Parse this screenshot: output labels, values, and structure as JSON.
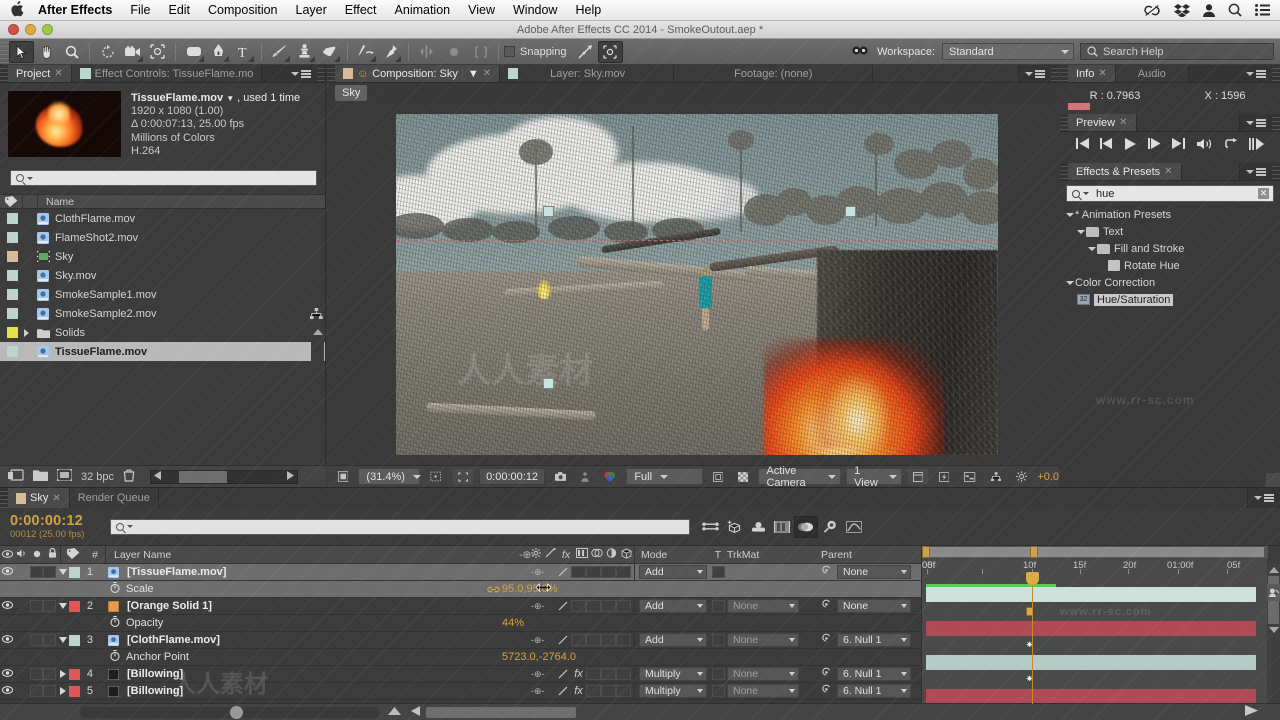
{
  "menubar": {
    "apple_icon": "apple-icon",
    "items": [
      {
        "label": "After Effects",
        "bold": true,
        "highlight": false
      },
      {
        "label": "File",
        "bold": false,
        "highlight": false
      },
      {
        "label": "Edit",
        "bold": false,
        "highlight": false
      },
      {
        "label": "Composition",
        "bold": false,
        "highlight": false
      },
      {
        "label": "Layer",
        "bold": false,
        "highlight": true
      },
      {
        "label": "Effect",
        "bold": false,
        "highlight": false
      },
      {
        "label": "Animation",
        "bold": false,
        "highlight": false
      },
      {
        "label": "View",
        "bold": false,
        "highlight": false
      },
      {
        "label": "Window",
        "bold": false,
        "highlight": false
      },
      {
        "label": "Help",
        "bold": false,
        "highlight": false
      }
    ],
    "status_icons": [
      "creative-cloud-icon",
      "dropbox-icon",
      "user-icon",
      "spotlight-search-icon",
      "notification-list-icon"
    ]
  },
  "titlebar": {
    "title": "Adobe After Effects CC 2014 - SmokeOutout.aep *",
    "close_color": "#d0524b",
    "minimize_color": "#dfa93b",
    "zoom_color": "#9ec94a"
  },
  "toolbar": {
    "tools": [
      {
        "name": "selection-tool",
        "selected": true
      },
      {
        "name": "hand-tool",
        "selected": false
      },
      {
        "name": "zoom-tool",
        "selected": false
      },
      {
        "name": "rotation-tool",
        "selected": false
      },
      {
        "name": "camera-tool",
        "selected": false
      },
      {
        "name": "pan-behind-tool",
        "selected": false
      },
      {
        "name": "shape-tool",
        "selected": false
      },
      {
        "name": "pen-tool",
        "selected": false
      },
      {
        "name": "type-tool",
        "selected": false
      },
      {
        "name": "brush-tool",
        "selected": false
      },
      {
        "name": "clone-stamp-tool",
        "selected": false
      },
      {
        "name": "eraser-tool",
        "selected": false
      },
      {
        "name": "roto-brush-tool",
        "selected": false
      },
      {
        "name": "puppet-pin-tool",
        "selected": false
      }
    ],
    "snapping_label": "Snapping",
    "snapping_checked": false,
    "workspace_label": "Workspace:",
    "workspace_value": "Standard",
    "search_help_placeholder": "Search Help"
  },
  "project": {
    "tabs": [
      {
        "label": "Project",
        "active": true,
        "closable": true
      },
      {
        "label": "Effect Controls: TissueFlame.mo",
        "active": false,
        "closable": false
      }
    ],
    "selected_asset": {
      "name": "TissueFlame.mov",
      "used": ", used 1 time",
      "dimensions": "1920 x 1080 (1.00)",
      "duration": "Δ 0:00:07:13, 25.00 fps",
      "colors": "Millions of Colors",
      "codec": "H.264"
    },
    "search_placeholder": "",
    "column_header": "Name",
    "items": [
      {
        "name": "ClothFlame.mov",
        "swatch": "#bcd4cd",
        "icon": "movie-icon",
        "selected": false,
        "folder": false
      },
      {
        "name": "FlameShot2.mov",
        "swatch": "#bcd4cd",
        "icon": "movie-icon",
        "selected": false,
        "folder": false
      },
      {
        "name": "Sky",
        "swatch": "#d7bb96",
        "icon": "composition-icon",
        "selected": false,
        "folder": false
      },
      {
        "name": "Sky.mov",
        "swatch": "#bcd4cd",
        "icon": "movie-icon",
        "selected": false,
        "folder": false
      },
      {
        "name": "SmokeSample1.mov",
        "swatch": "#bcd4cd",
        "icon": "movie-icon",
        "selected": false,
        "folder": false
      },
      {
        "name": "SmokeSample2.mov",
        "swatch": "#bcd4cd",
        "icon": "movie-icon",
        "selected": false,
        "folder": false
      },
      {
        "name": "Solids",
        "swatch": "#e3e04a",
        "icon": "folder-icon",
        "selected": false,
        "folder": true
      },
      {
        "name": "TissueFlame.mov",
        "swatch": "#bcd4cd",
        "icon": "movie-icon",
        "selected": true,
        "folder": false
      }
    ],
    "bottom": {
      "bit_depth": "32 bpc",
      "icons": [
        "new-comp-icon",
        "new-folder-icon",
        "interpret-footage-icon",
        "delete-icon"
      ]
    }
  },
  "composition": {
    "tabs": [
      {
        "label": "Composition: Sky",
        "active": true
      },
      {
        "label": "Layer: Sky.mov",
        "active": false
      },
      {
        "label": "Footage: (none)",
        "active": false
      }
    ],
    "breadcrumb": "Sky",
    "bottom": {
      "zoom": "(31.4%)",
      "timecode": "0:00:00:12",
      "resolution": "Full",
      "view_camera": "Active Camera",
      "views": "1 View",
      "exposure": "+0.0"
    }
  },
  "info_panel": {
    "tabs": [
      {
        "label": "Info",
        "active": true
      },
      {
        "label": "Audio",
        "active": false
      }
    ],
    "r_label": "R : 0.7963",
    "x_label": "X : 1596"
  },
  "preview_panel": {
    "tabs": [
      {
        "label": "Preview",
        "active": true
      }
    ],
    "buttons": [
      "first-frame-icon",
      "previous-frame-icon",
      "play-icon",
      "next-frame-icon",
      "last-frame-icon",
      "audio-icon",
      "loop-icon",
      "ram-preview-icon"
    ]
  },
  "effects_panel": {
    "tabs": [
      {
        "label": "Effects & Presets",
        "active": true
      }
    ],
    "search_value": "hue",
    "tree": [
      {
        "label": "* Animation Presets",
        "depth": 0,
        "type": "group",
        "expanded": true,
        "selected": false
      },
      {
        "label": "Text",
        "depth": 1,
        "type": "folder",
        "expanded": true,
        "selected": false
      },
      {
        "label": "Fill and Stroke",
        "depth": 2,
        "type": "folder",
        "expanded": true,
        "selected": false
      },
      {
        "label": "Rotate Hue",
        "depth": 3,
        "type": "preset",
        "expanded": false,
        "selected": false
      },
      {
        "label": "Color Correction",
        "depth": 0,
        "type": "group",
        "expanded": true,
        "selected": false
      },
      {
        "label": "Hue/Saturation",
        "depth": 1,
        "type": "effect",
        "expanded": false,
        "selected": true
      }
    ]
  },
  "timeline": {
    "tabs": [
      {
        "label": "Sky",
        "active": true
      },
      {
        "label": "Render Queue",
        "active": false
      }
    ],
    "current_time": "0:00:00:12",
    "frame_info": "00012 (25.00 fps)",
    "search_placeholder": "",
    "switch_icons": [
      "live-update-icon",
      "draft-3d-icon",
      "hide-shy-icon",
      "frame-blending-icon",
      "motion-blur-icon",
      "graph-editor-toggle-icon",
      "graph-editor-icon"
    ],
    "columns": {
      "av": "",
      "label": "",
      "number": "#",
      "layer_name": "Layer Name",
      "mode": "Mode",
      "t": "T",
      "trkmat": "TrkMat",
      "parent": "Parent"
    },
    "ruler_ticks": [
      "00f",
      "05f",
      "10f",
      "15f",
      "20f",
      "01:00f",
      "05f"
    ],
    "layers": [
      {
        "index": "1",
        "name": "[TissueFlame.mov]",
        "swatch": "#bcd4cd",
        "visible": true,
        "mode": "Add",
        "trkmat": "",
        "parent": "None",
        "has_fx": false,
        "expanded": true,
        "bar_color": "#cfe0da",
        "selected": true,
        "property": {
          "name": "Scale",
          "value": "95.0,95.0%",
          "linked": true,
          "selected": true,
          "keyframe": true
        }
      },
      {
        "index": "2",
        "name": "[Orange Solid 1]",
        "swatch": "#e05555",
        "visible": true,
        "mode": "Add",
        "trkmat": "None",
        "parent": "None",
        "has_fx": false,
        "expanded": true,
        "bar_color": "#b04a55",
        "selected": false,
        "property": {
          "name": "Opacity",
          "value": "44%",
          "linked": false,
          "selected": false,
          "keyframe": true
        }
      },
      {
        "index": "3",
        "name": "[ClothFlame.mov]",
        "swatch": "#bcd4cd",
        "visible": true,
        "mode": "Add",
        "trkmat": "None",
        "parent": "6. Null 1",
        "has_fx": false,
        "expanded": true,
        "bar_color": "#b6cbc6",
        "selected": false,
        "property": {
          "name": "Anchor Point",
          "value": "5723.0,-2764.0",
          "linked": false,
          "selected": false,
          "keyframe": true
        }
      },
      {
        "index": "4",
        "name": "[Billowing]",
        "swatch": "#e05555",
        "visible": true,
        "mode": "Multiply",
        "trkmat": "None",
        "parent": "6. Null 1",
        "has_fx": true,
        "expanded": false,
        "bar_color": "#b04a55",
        "selected": false,
        "property": null
      },
      {
        "index": "5",
        "name": "[Billowing]",
        "swatch": "#e05555",
        "visible": true,
        "mode": "Multiply",
        "trkmat": "None",
        "parent": "6. Null 1",
        "has_fx": true,
        "expanded": false,
        "bar_color": "#b04a55",
        "selected": false,
        "property": null
      }
    ]
  },
  "watermarks": [
    "www.rr-sc.com",
    "人人素材"
  ],
  "colors": {
    "accent_amber": "#d8a33c",
    "panel_bg": "#3a3a3a",
    "header_bg": "#4a4a4a",
    "selection": "#b9b9b9"
  }
}
